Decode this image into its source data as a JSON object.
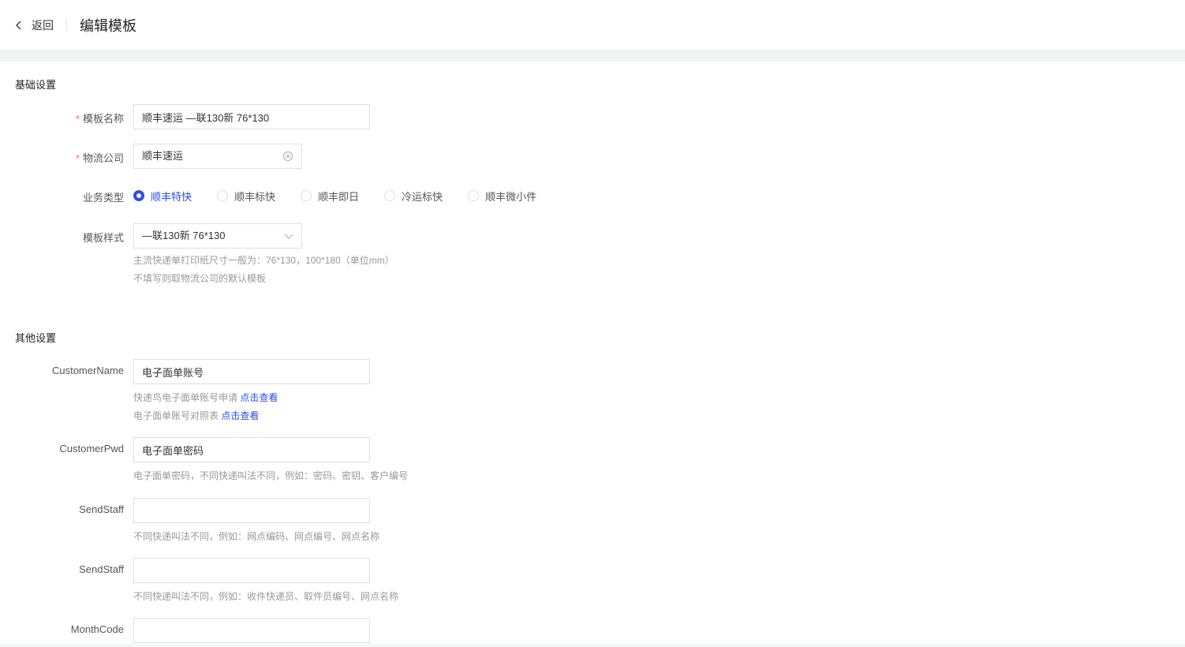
{
  "header": {
    "back_label": "返回",
    "title": "编辑模板"
  },
  "basic": {
    "section_title": "基础设置",
    "template_name": {
      "label": "模板名称",
      "value": "顺丰速运 —联130新 76*130"
    },
    "logistics": {
      "label": "物流公司",
      "value": "顺丰速运"
    },
    "business_type": {
      "label": "业务类型",
      "options": [
        "顺丰特快",
        "顺丰标快",
        "顺丰即日",
        "冷运标快",
        "顺丰微小件"
      ],
      "selected": "顺丰特快"
    },
    "template_style": {
      "label": "模板样式",
      "value": "—联130新 76*130",
      "hint1": "主流快递单打印纸尺寸一般为：76*130，100*180（单位mm）",
      "hint2": "不填写则取物流公司的默认模板"
    }
  },
  "other": {
    "section_title": "其他设置",
    "customer_name": {
      "label": "CustomerName",
      "value": "电子面单账号",
      "hint1": "快递鸟电子面单账号申请",
      "hint1_link": "点击查看",
      "hint2": "电子面单账号对照表",
      "hint2_link": "点击查看"
    },
    "customer_pwd": {
      "label": "CustomerPwd",
      "value": "电子面单密码",
      "hint": "电子面单密码，不同快递叫法不同，例如：密码、密钥、客户编号"
    },
    "send_staff_1": {
      "label": "SendStaff",
      "value": "",
      "hint": "不同快递叫法不同，例如：网点编码、网点编号、网点名称"
    },
    "send_staff_2": {
      "label": "SendStaff",
      "value": "",
      "hint": "不同快递叫法不同，例如：收件快递员、取件员编号、网点名称"
    },
    "month_code": {
      "label": "MonthCode",
      "value": ""
    }
  },
  "colors": {
    "accent": "#2b4df0",
    "required": "#f56c6c"
  }
}
